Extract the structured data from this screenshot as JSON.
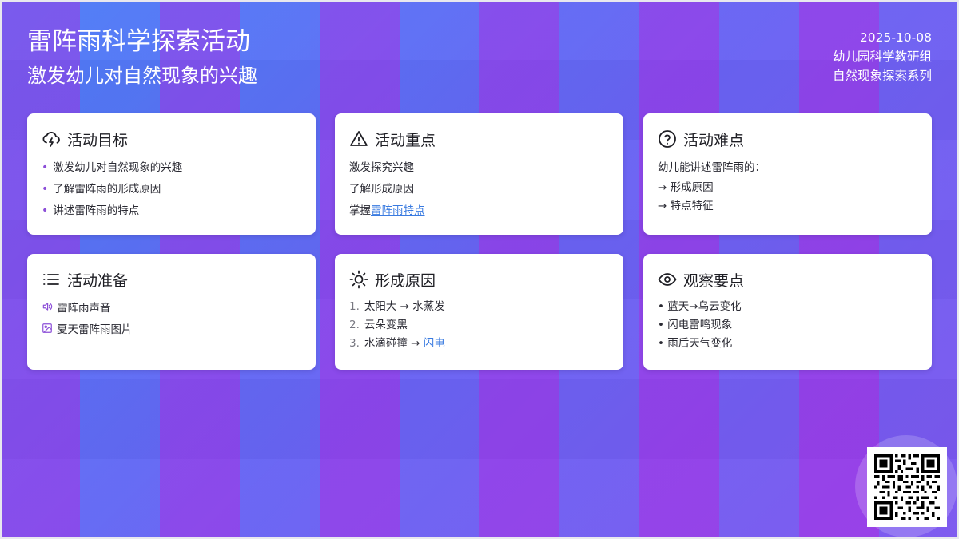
{
  "header": {
    "title": "雷阵雨科学探索活动",
    "subtitle": "激发幼儿对自然现象的兴趣",
    "date": "2025-10-08",
    "org": "幼儿园科学教研组",
    "series": "自然现象探索系列"
  },
  "cards": {
    "goals": {
      "title": "活动目标",
      "icon": "cloud-lightning-icon",
      "items": [
        "激发幼儿对自然现象的兴趣",
        "了解雷阵雨的形成原因",
        "讲述雷阵雨的特点"
      ]
    },
    "focus": {
      "title": "活动重点",
      "icon": "warning-triangle-icon",
      "items": [
        "激发探究兴趣",
        "了解形成原因"
      ],
      "link_prefix": "掌握",
      "link_text": "雷阵雨特点"
    },
    "difficulty": {
      "title": "活动难点",
      "icon": "question-circle-icon",
      "intro": "幼儿能讲述雷阵雨的：",
      "items": [
        "→ 形成原因",
        "→ 特点特征"
      ]
    },
    "preparation": {
      "title": "活动准备",
      "icon": "list-icon",
      "items": [
        {
          "icon": "speaker-icon",
          "text": "雷阵雨声音"
        },
        {
          "icon": "image-icon",
          "text": "夏天雷阵雨图片"
        }
      ]
    },
    "causes": {
      "title": "形成原因",
      "icon": "sun-icon",
      "steps": [
        {
          "num": "1.",
          "text": "太阳大 → 水蒸发"
        },
        {
          "num": "2.",
          "text": "云朵变黑"
        },
        {
          "num": "3.",
          "text": "水滴碰撞 → ",
          "highlight": "闪电"
        }
      ]
    },
    "observation": {
      "title": "观察要点",
      "icon": "eye-icon",
      "items": [
        "• 蓝天→乌云变化",
        "• 闪电雷鸣现象",
        "• 雨后天气变化"
      ]
    }
  },
  "qr": {
    "icon": "qr-code-icon"
  },
  "colors": {
    "accent_purple": "#8c4fd8",
    "link_blue": "#3a7be0",
    "card_bg": "#ffffff",
    "text_dark": "#1e1e24"
  }
}
